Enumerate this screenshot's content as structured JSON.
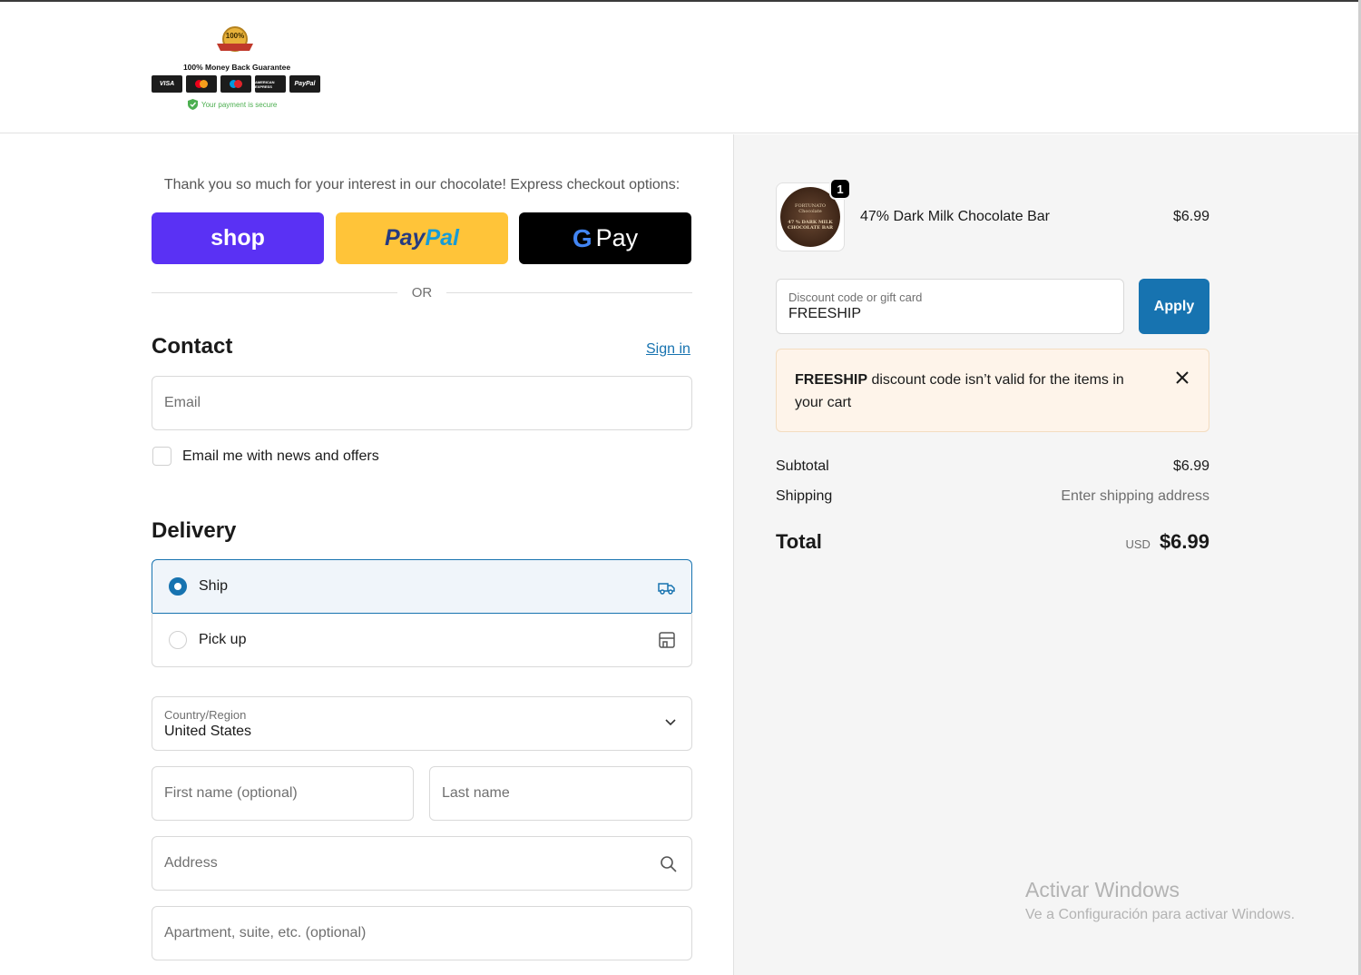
{
  "header": {
    "seal_text": "100%",
    "guarantee": "100% Money Back Guarantee",
    "cards": [
      "VISA",
      "MasterCard",
      "Maestro",
      "AMERICAN EXPRESS",
      "PayPal"
    ],
    "secure_text": "Your payment is secure"
  },
  "express": {
    "title": "Thank you so much for your interest in our chocolate! Express checkout options:",
    "shop_label": "shop",
    "paypal_label_1": "Pay",
    "paypal_label_2": "Pal",
    "gpay_g": "G",
    "gpay_label": "Pay",
    "or_label": "OR"
  },
  "contact": {
    "title": "Contact",
    "signin": "Sign in",
    "email_placeholder": "Email",
    "newsletter_label": "Email me with news and offers"
  },
  "delivery": {
    "title": "Delivery",
    "options": [
      {
        "label": "Ship",
        "selected": true
      },
      {
        "label": "Pick up",
        "selected": false
      }
    ],
    "country_label": "Country/Region",
    "country_value": "United States",
    "first_name_placeholder": "First name (optional)",
    "last_name_placeholder": "Last name",
    "address_placeholder": "Address",
    "apartment_placeholder": "Apartment, suite, etc. (optional)"
  },
  "summary": {
    "product": {
      "name": "47% Dark Milk Chocolate Bar",
      "price": "$6.99",
      "quantity": "1",
      "image_text_1": "FORTUNATO",
      "image_text_2": "Chocolate",
      "image_text_3": "47 % DARK MILK",
      "image_text_4": "CHOCOLATE BAR"
    },
    "discount_label": "Discount code or gift card",
    "discount_value": "FREESHIP",
    "apply_label": "Apply",
    "alert_code": "FREESHIP",
    "alert_text": " discount code isn’t valid for the items in your cart",
    "subtotal_label": "Subtotal",
    "subtotal_value": "$6.99",
    "shipping_label": "Shipping",
    "shipping_value": "Enter shipping address",
    "total_label": "Total",
    "currency": "USD",
    "total_value": "$6.99"
  },
  "watermark": {
    "line1": "Activar Windows",
    "line2": "Ve a Configuración para activar Windows."
  },
  "colors": {
    "accent": "#1773b0",
    "shop": "#5a31f4",
    "paypal": "#ffc439",
    "alert_bg": "#fef4ea"
  }
}
